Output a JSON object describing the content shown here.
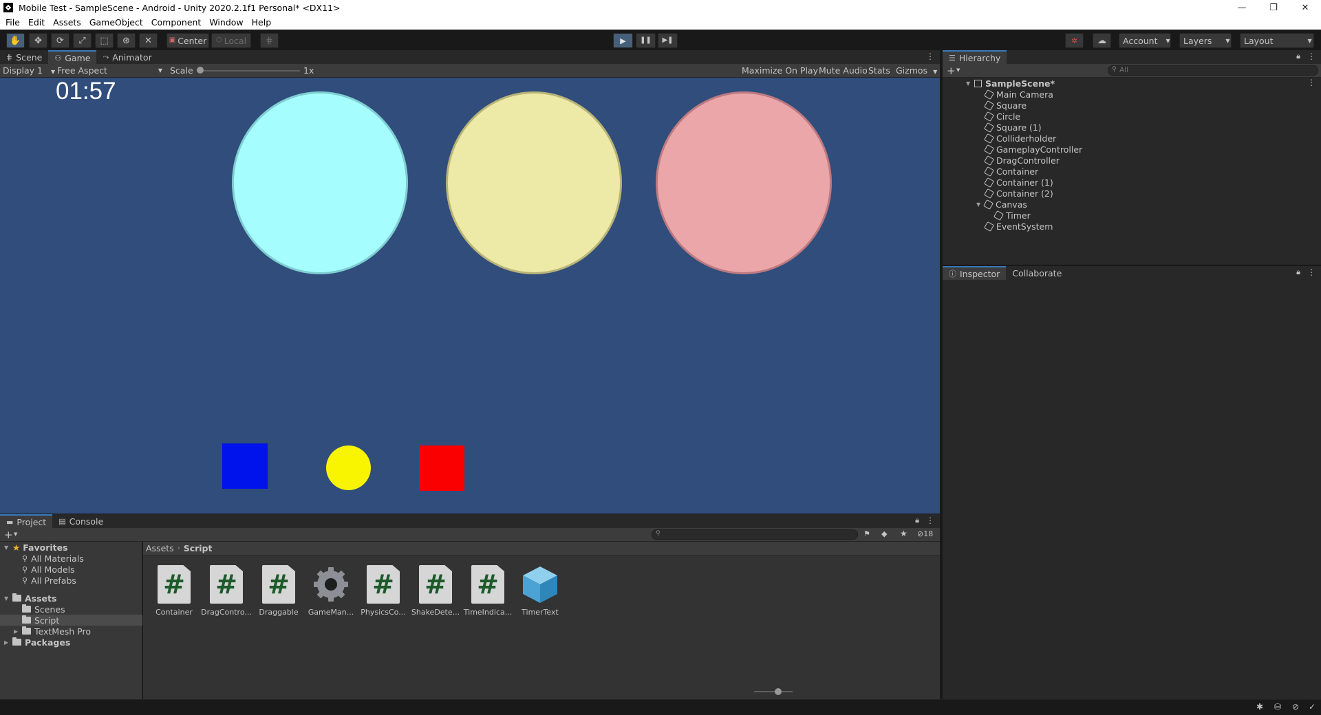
{
  "window": {
    "title": "Mobile Test - SampleScene - Android - Unity 2020.2.1f1 Personal* <DX11>",
    "controls": {
      "minimize": "—",
      "restore": "❐",
      "close": "✕"
    }
  },
  "menu": [
    "File",
    "Edit",
    "Assets",
    "GameObject",
    "Component",
    "Window",
    "Help"
  ],
  "toolbar": {
    "pivot_mode": "Center",
    "pivot_rotation": "Local",
    "account": "Account",
    "layers": "Layers",
    "layout": "Layout"
  },
  "game_panel": {
    "tabs": [
      "Scene",
      "Game",
      "Animator"
    ],
    "display": "Display 1",
    "aspect": "Free Aspect",
    "scale_label": "Scale",
    "scale_value": "1x",
    "scale_level": 0.0,
    "maximize": "Maximize On Play",
    "mute": "Mute Audio",
    "stats": "Stats",
    "gizmos": "Gizmos",
    "timer": "01:57",
    "colors": {
      "background": "#304d7b",
      "circle_cyan": "#a6fdfd",
      "circle_yellow": "#eceaa6",
      "circle_pink": "#eba6a9",
      "blue_square": "#0013ec",
      "yellow_circle": "#f9f500",
      "red_square": "#fb0000"
    }
  },
  "hierarchy": {
    "tab": "Hierarchy",
    "search_placeholder": "All",
    "scene": "SampleScene*",
    "items": [
      "Main Camera",
      "Square",
      "Circle",
      "Square (1)",
      "Colliderholder",
      "GameplayController",
      "DragController",
      "Container",
      "Container (1)",
      "Container (2)",
      "Canvas",
      "Timer",
      "EventSystem"
    ]
  },
  "inspector": {
    "tabs": [
      "Inspector",
      "Collaborate"
    ]
  },
  "project": {
    "tabs": [
      "Project",
      "Console"
    ],
    "hidden_count": "18",
    "breadcrumb": [
      "Assets",
      "Script"
    ],
    "favorites": "Favorites",
    "favorite_items": [
      "All Materials",
      "All Models",
      "All Prefabs"
    ],
    "assets_root": "Assets",
    "asset_folders": [
      "Scenes",
      "Script",
      "TextMesh Pro"
    ],
    "packages": "Packages",
    "files": [
      {
        "name": "Container",
        "kind": "script"
      },
      {
        "name": "DragContro...",
        "kind": "script"
      },
      {
        "name": "Draggable",
        "kind": "script"
      },
      {
        "name": "GameMan...",
        "kind": "gear"
      },
      {
        "name": "PhysicsCo...",
        "kind": "script"
      },
      {
        "name": "ShakeDete...",
        "kind": "script"
      },
      {
        "name": "TimeIndica...",
        "kind": "script"
      },
      {
        "name": "TimerText",
        "kind": "prefab"
      }
    ],
    "zoom_level": 0.7
  }
}
